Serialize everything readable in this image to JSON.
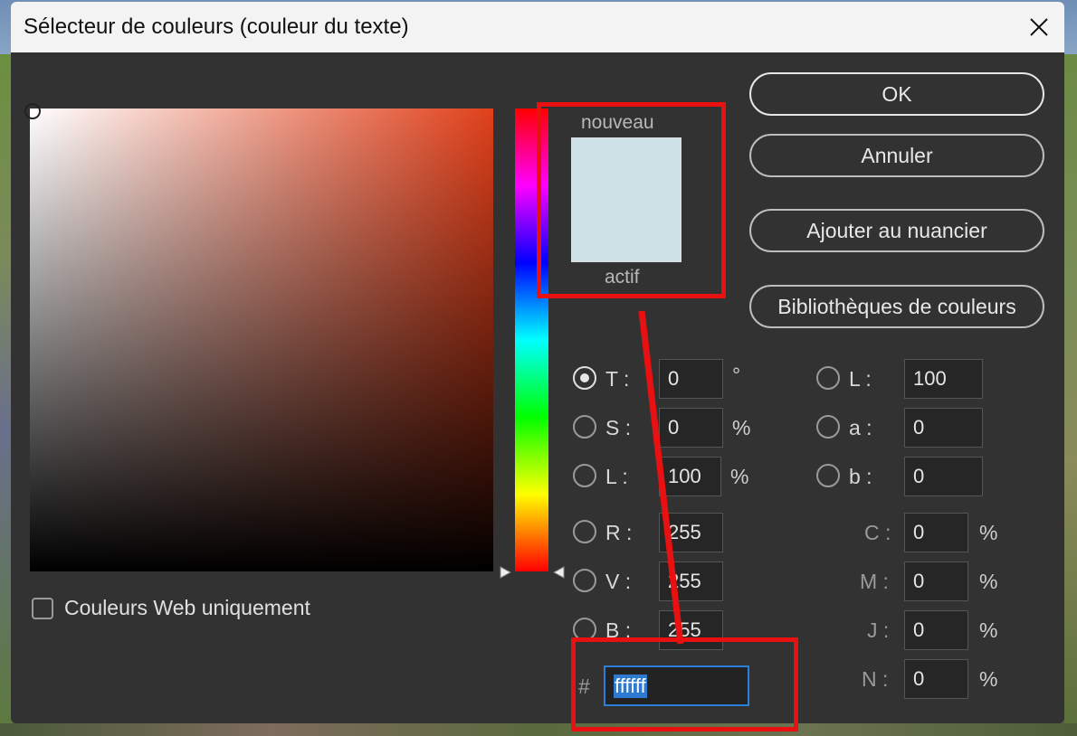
{
  "window": {
    "title": "Sélecteur de couleurs (couleur du texte)"
  },
  "swatch": {
    "new_label": "nouveau",
    "current_label": "actif",
    "new_color": "#cde2e6",
    "current_color": "#cde2e6"
  },
  "buttons": {
    "ok": "OK",
    "cancel": "Annuler",
    "add_swatches": "Ajouter au nuancier",
    "libraries": "Bibliothèques de couleurs"
  },
  "hsb": {
    "h": {
      "label": "T :",
      "value": "0",
      "unit": "°"
    },
    "s": {
      "label": "S :",
      "value": "0",
      "unit": "%"
    },
    "b": {
      "label": "L :",
      "value": "100",
      "unit": "%"
    }
  },
  "rgb": {
    "r": {
      "label": "R :",
      "value": "255"
    },
    "g": {
      "label": "V :",
      "value": "255"
    },
    "b": {
      "label": "B :",
      "value": "255"
    }
  },
  "lab": {
    "l": {
      "label": "L :",
      "value": "100"
    },
    "a": {
      "label": "a :",
      "value": "0"
    },
    "b": {
      "label": "b :",
      "value": "0"
    }
  },
  "cmyk": {
    "c": {
      "label": "C :",
      "value": "0",
      "unit": "%"
    },
    "m": {
      "label": "M :",
      "value": "0",
      "unit": "%"
    },
    "y": {
      "label": "J :",
      "value": "0",
      "unit": "%"
    },
    "k": {
      "label": "N :",
      "value": "0",
      "unit": "%"
    }
  },
  "hex": {
    "symbol": "#",
    "value": "ffffff"
  },
  "web_only": {
    "label": "Couleurs Web uniquement",
    "checked": false
  },
  "colors": {
    "annotation": "#e81010",
    "hex_focus": "#2b7fd8"
  }
}
